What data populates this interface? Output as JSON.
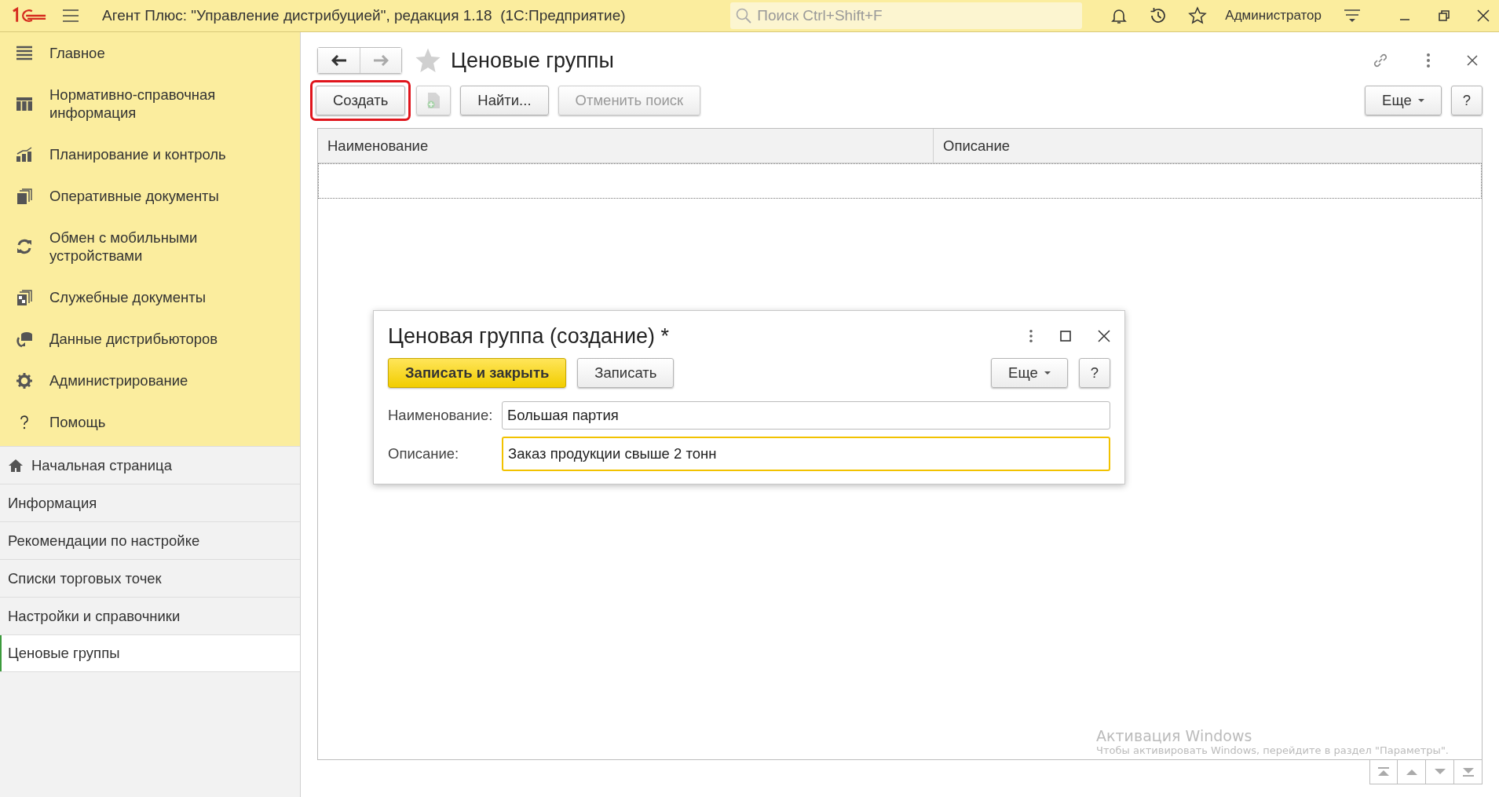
{
  "app_bar": {
    "title": "Агент Плюс: \"Управление дистрибуцией\", редакция 1.18  (1С:Предприятие)",
    "search": {
      "placeholder": "Поиск Ctrl+Shift+F"
    },
    "user": "Администратор"
  },
  "sections": [
    {
      "label": "Главное",
      "kind": "menu"
    },
    {
      "label": "Нормативно-справочная информация",
      "kind": "grid"
    },
    {
      "label": "Планирование и контроль",
      "kind": "chart"
    },
    {
      "label": "Оперативные документы",
      "kind": "docs"
    },
    {
      "label": "Обмен с мобильными устройствами",
      "kind": "sync"
    },
    {
      "label": "Служебные документы",
      "kind": "servicedocs"
    },
    {
      "label": "Данные дистрибьюторов",
      "kind": "data"
    },
    {
      "label": "Администрирование",
      "kind": "gear"
    },
    {
      "label": "Помощь",
      "kind": "help"
    }
  ],
  "open_pages": [
    {
      "label": "Начальная страница",
      "kind": "home",
      "selected": false
    },
    {
      "label": "Информация",
      "kind": "page",
      "selected": false
    },
    {
      "label": "Рекомендации по настройке",
      "kind": "page",
      "selected": false
    },
    {
      "label": "Списки торговых точек",
      "kind": "page",
      "selected": false
    },
    {
      "label": "Настройки и справочники",
      "kind": "page",
      "selected": false
    },
    {
      "label": "Ценовые группы",
      "kind": "page",
      "selected": true
    }
  ],
  "form": {
    "title": "Ценовые группы",
    "back_disabled": false,
    "forward_disabled": true,
    "favorite": false,
    "toolbar": [
      {
        "kind": "text",
        "label": "Создать",
        "disabled": false,
        "highlighted": true
      },
      {
        "kind": "copy",
        "disabled": true,
        "highlighted": false
      },
      {
        "kind": "text",
        "label": "Найти...",
        "disabled": false,
        "highlighted": false
      },
      {
        "kind": "text",
        "label": "Отменить поиск",
        "disabled": true,
        "highlighted": false
      }
    ],
    "more": "Еще",
    "help": "?",
    "table": {
      "columns": [
        "Наименование",
        "Описание"
      ]
    }
  },
  "dialog": {
    "title": "Ценовая группа (создание) *",
    "save_close": "Записать и закрыть",
    "save": "Записать",
    "more": "Еще",
    "help": "?",
    "fields": [
      {
        "label": "Наименование:",
        "value": "Большая партия",
        "focused": false
      },
      {
        "label": "Описание:",
        "value": "Заказ продукции свыше 2 тонн",
        "focused": true
      }
    ]
  },
  "activation": {
    "title": "Активация Windows",
    "text": "Чтобы активировать Windows, перейдите в раздел \"Параметры\"."
  }
}
